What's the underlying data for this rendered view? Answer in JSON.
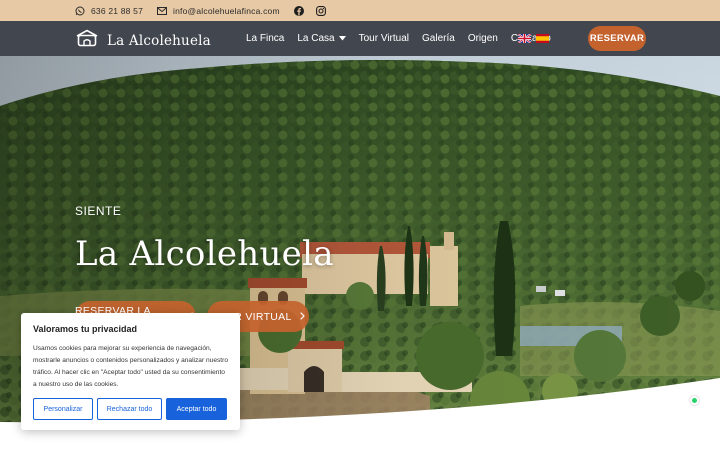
{
  "topbar": {
    "phone": "636 21 88 57",
    "email": "info@alcolehuelafinca.com",
    "icons": [
      "whatsapp-icon",
      "mail-icon",
      "facebook-icon",
      "instagram-icon"
    ]
  },
  "nav": {
    "logo_text": "La Alcolehuela",
    "items": [
      "La Finca",
      "La Casa",
      "Tour Virtual",
      "Galería",
      "Origen",
      "Contacto"
    ],
    "languages": [
      "English",
      "Español"
    ],
    "reserve_label": "RESERVAR"
  },
  "hero": {
    "eyebrow": "SIENTE",
    "title": "La Alcolehuela",
    "button_book": "RESERVAR LA CASA",
    "button_tour": "TOUR VIRTUAL"
  },
  "cookie": {
    "title": "Valoramos tu privacidad",
    "text": "Usamos cookies para mejorar su experiencia de navegación, mostrarle anuncios o contenidos personalizados y analizar nuestro tráfico. Al hacer clic en \"Aceptar todo\" usted da su consentimiento a nuestro uso de las cookies.",
    "btn_customize": "Personalizar",
    "btn_reject": "Rechazar todo",
    "btn_accept": "Aceptar todo"
  },
  "colors": {
    "topbar": "#e8c9a5",
    "nav": "#3a4048",
    "accent": "#c4622d",
    "cookie_blue": "#1863dc"
  }
}
